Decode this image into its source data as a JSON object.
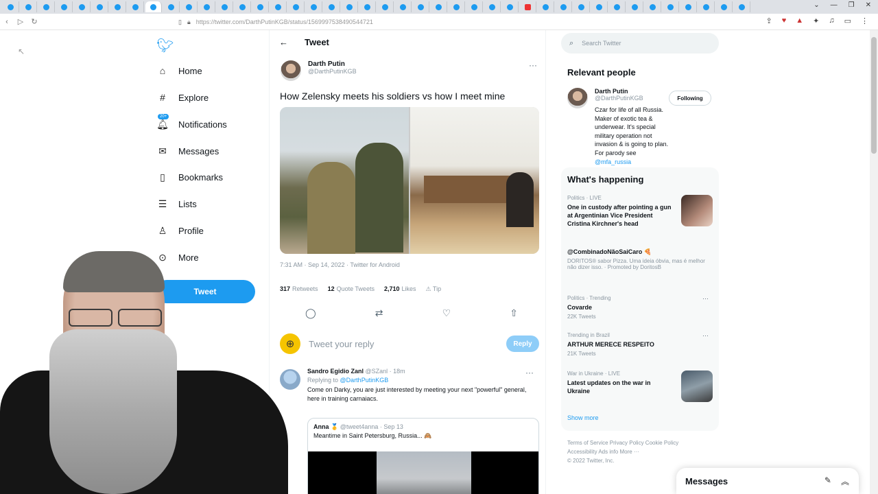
{
  "browser": {
    "url": "https://twitter.com/DarthPutinKGB/status/1569997538490544721"
  },
  "nav": {
    "items": [
      {
        "label": "Home",
        "icon": "home-icon"
      },
      {
        "label": "Explore",
        "icon": "hashtag-icon"
      },
      {
        "label": "Notifications",
        "icon": "bell-icon"
      },
      {
        "label": "Messages",
        "icon": "envelope-icon"
      },
      {
        "label": "Bookmarks",
        "icon": "bookmark-icon"
      },
      {
        "label": "Lists",
        "icon": "list-icon"
      },
      {
        "label": "Profile",
        "icon": "person-icon"
      },
      {
        "label": "More",
        "icon": "more-circle-icon"
      }
    ],
    "notif_badge": "20+",
    "tweet_button": "Tweet"
  },
  "main": {
    "header": "Tweet",
    "author_name": "Darth Putin",
    "author_handle": "@DarthPutinKGB",
    "text": "How Zelensky meets his soldiers vs how I meet mine",
    "meta": "7:31 AM · Sep 14, 2022 · Twitter for Android",
    "retweets": "317",
    "retweets_label": "Retweets",
    "quotes": "12",
    "quotes_label": "Quote Tweets",
    "likes": "2,710",
    "likes_label": "Likes",
    "tip_label": "Tip",
    "reply_placeholder": "Tweet your reply",
    "reply_button": "Reply"
  },
  "reply": {
    "name": "Sandro Egidio Zanl",
    "handle": "@SZanl · 18m",
    "replying_prefix": "Replying to",
    "replying_to": "@DarthPutinKGB",
    "text": "Come on Darky, you are just interested by meeting your next \"powerful\" general, here in training carnaiacs.",
    "quote_name": "Anna 🥇",
    "quote_handle": "@tweet4anna · Sep 13",
    "quote_text": "Meantime in Saint Petersburg, Russia... 🙈"
  },
  "right": {
    "search_placeholder": "Search Twitter",
    "relevant_title": "Relevant people",
    "rp_name": "Darth Putin",
    "rp_handle": "@DarthPutinKGB",
    "rp_bio": "Czar for life of all Russia. Maker of exotic tea & underwear. It's special military operation not invasion & is going to plan. For parody see",
    "rp_bio_link": "@mfa_russia",
    "follow_button": "Following",
    "happening_title": "What's happening",
    "trends": [
      {
        "context": "Politics · LIVE",
        "title": "One in custody after pointing a gun at Argentinian Vice President Cristina Kirchner's head",
        "sub": ""
      },
      {
        "context": "",
        "title": "@CombinadoNãoSaiCaro 🍕",
        "sub": "DORITOS® sabor Pizza. Uma ideia óbvia, mas é melhor não dizer isso. · Promoted by DoritosB"
      },
      {
        "context": "Politics · Trending",
        "title": "Covarde",
        "sub": "22K Tweets"
      },
      {
        "context": "Trending in Brazil",
        "title": "ARTHUR MERECE RESPEITO",
        "sub": "21K Tweets"
      },
      {
        "context": "War in Ukraine · LIVE",
        "title": "Latest updates on the war in Ukraine",
        "sub": ""
      }
    ],
    "show_more": "Show more",
    "footer_line1": "Terms of Service   Privacy Policy   Cookie Policy",
    "footer_line2": "Accessibility   Ads info   More ···",
    "footer_line3": "© 2022 Twitter, Inc."
  },
  "messages_drawer": "Messages"
}
